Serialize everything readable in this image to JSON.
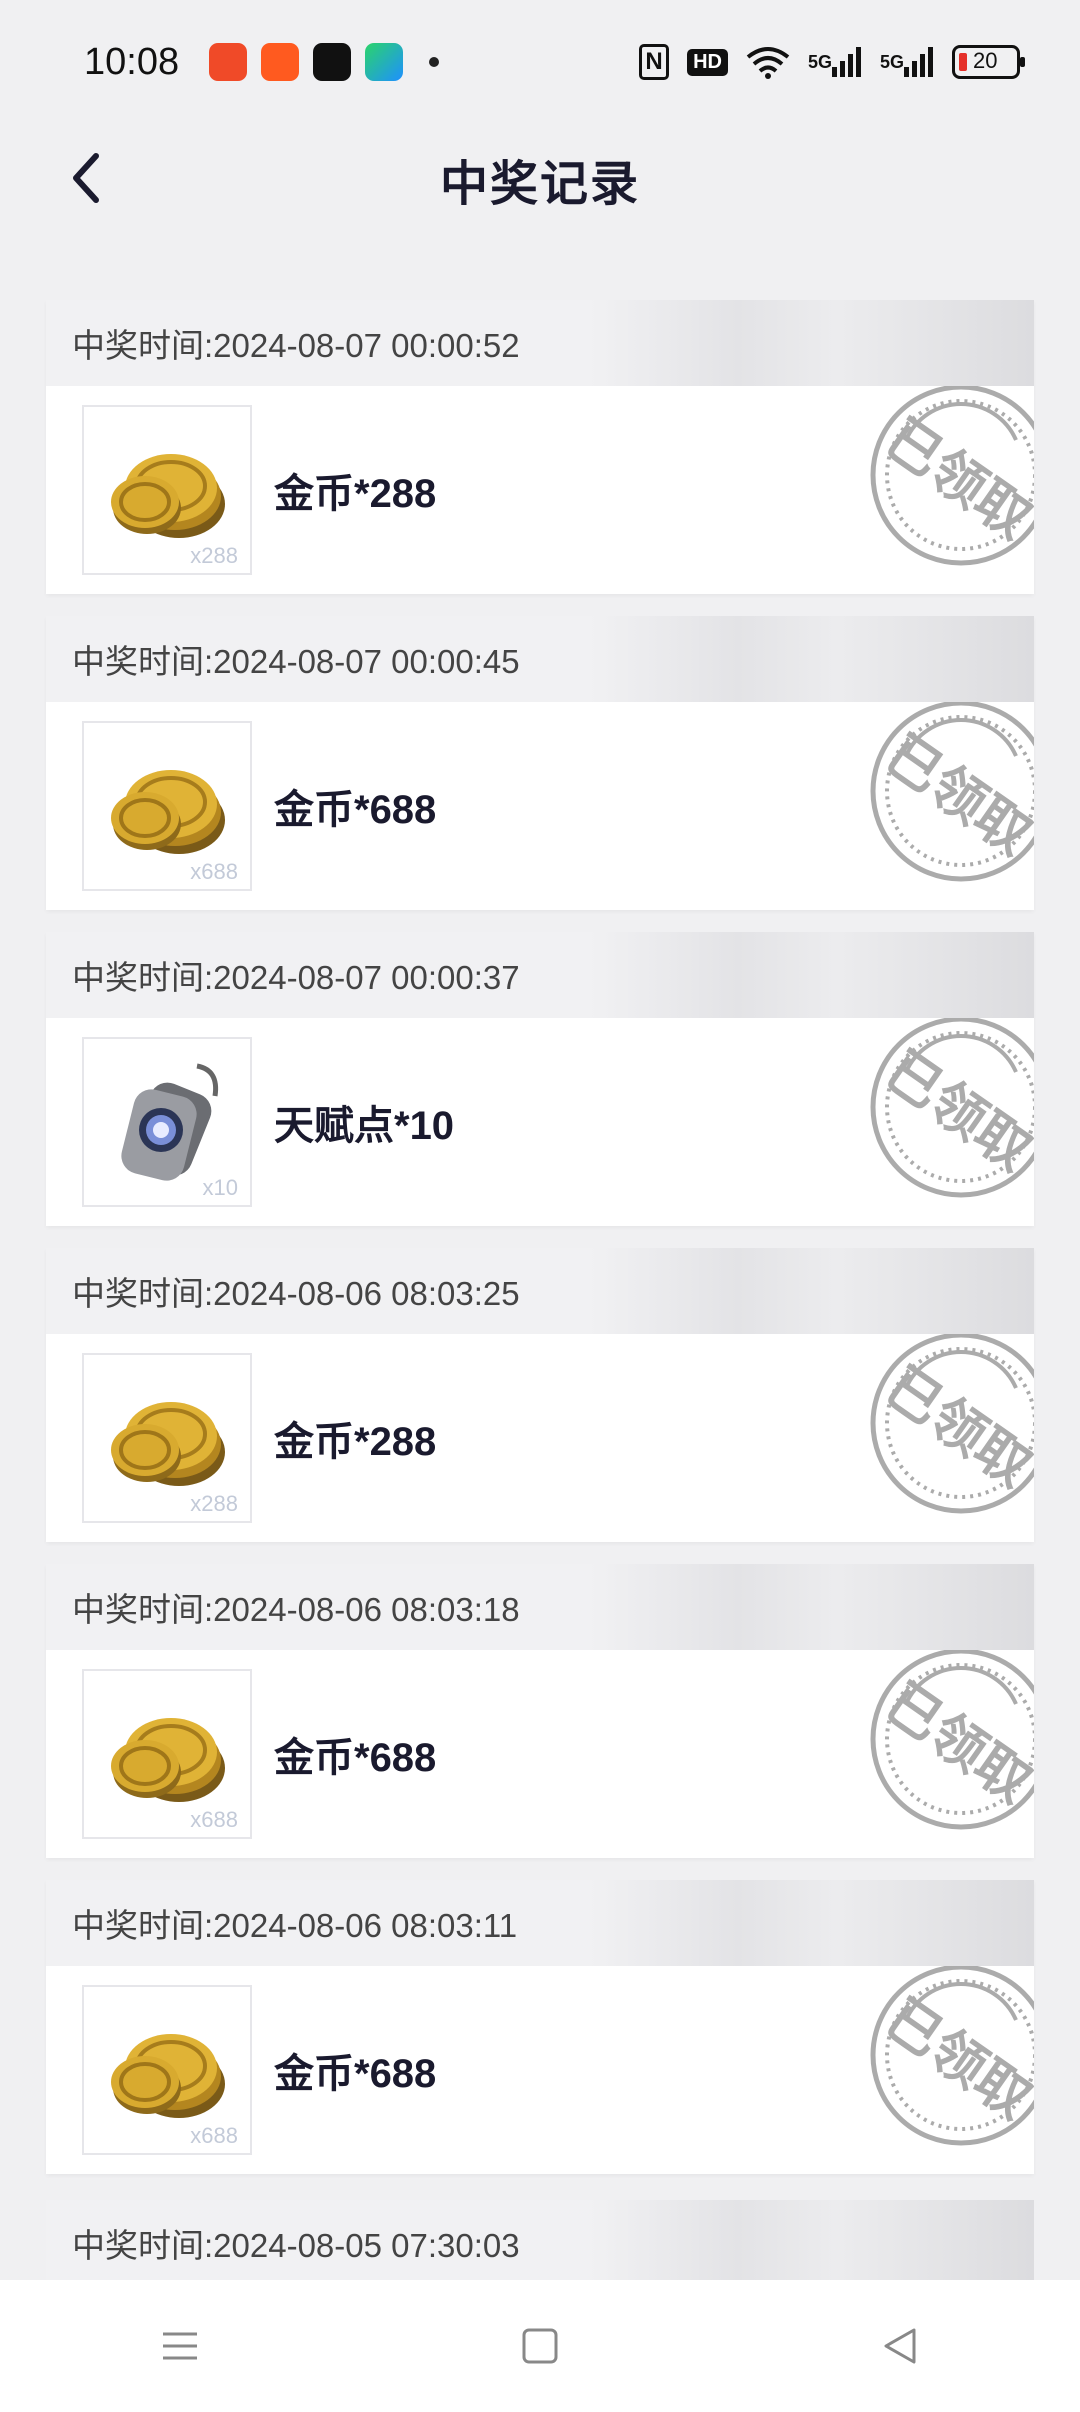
{
  "status": {
    "time": "10:08",
    "battery": "20",
    "network_labels": [
      "5G",
      "5G"
    ],
    "hd_label": "HD"
  },
  "header": {
    "title": "中奖记录"
  },
  "records": [
    {
      "time_label": "中奖时间:2024-08-07 00:00:52",
      "reward": "金币*288",
      "qty": "x288",
      "icon": "gold-coins-icon",
      "claimed_stamp": "已领取"
    },
    {
      "time_label": "中奖时间:2024-08-07 00:00:45",
      "reward": "金币*688",
      "qty": "x688",
      "icon": "gold-coins-icon",
      "claimed_stamp": "已领取"
    },
    {
      "time_label": "中奖时间:2024-08-07 00:00:37",
      "reward": "天赋点*10",
      "qty": "x10",
      "icon": "dog-tag-icon",
      "claimed_stamp": "已领取"
    },
    {
      "time_label": "中奖时间:2024-08-06 08:03:25",
      "reward": "金币*288",
      "qty": "x288",
      "icon": "gold-coins-icon",
      "claimed_stamp": "已领取"
    },
    {
      "time_label": "中奖时间:2024-08-06 08:03:18",
      "reward": "金币*688",
      "qty": "x688",
      "icon": "gold-coins-icon",
      "claimed_stamp": "已领取"
    },
    {
      "time_label": "中奖时间:2024-08-06 08:03:11",
      "reward": "金币*688",
      "qty": "x688",
      "icon": "gold-coins-icon",
      "claimed_stamp": "已领取"
    }
  ],
  "partial_record": {
    "time_label": "中奖时间:2024-08-05 07:30:03"
  },
  "colors": {
    "title": "#1a1a2e",
    "stamp": "#a8a8a8",
    "coin_gold": "#d9a92a"
  }
}
